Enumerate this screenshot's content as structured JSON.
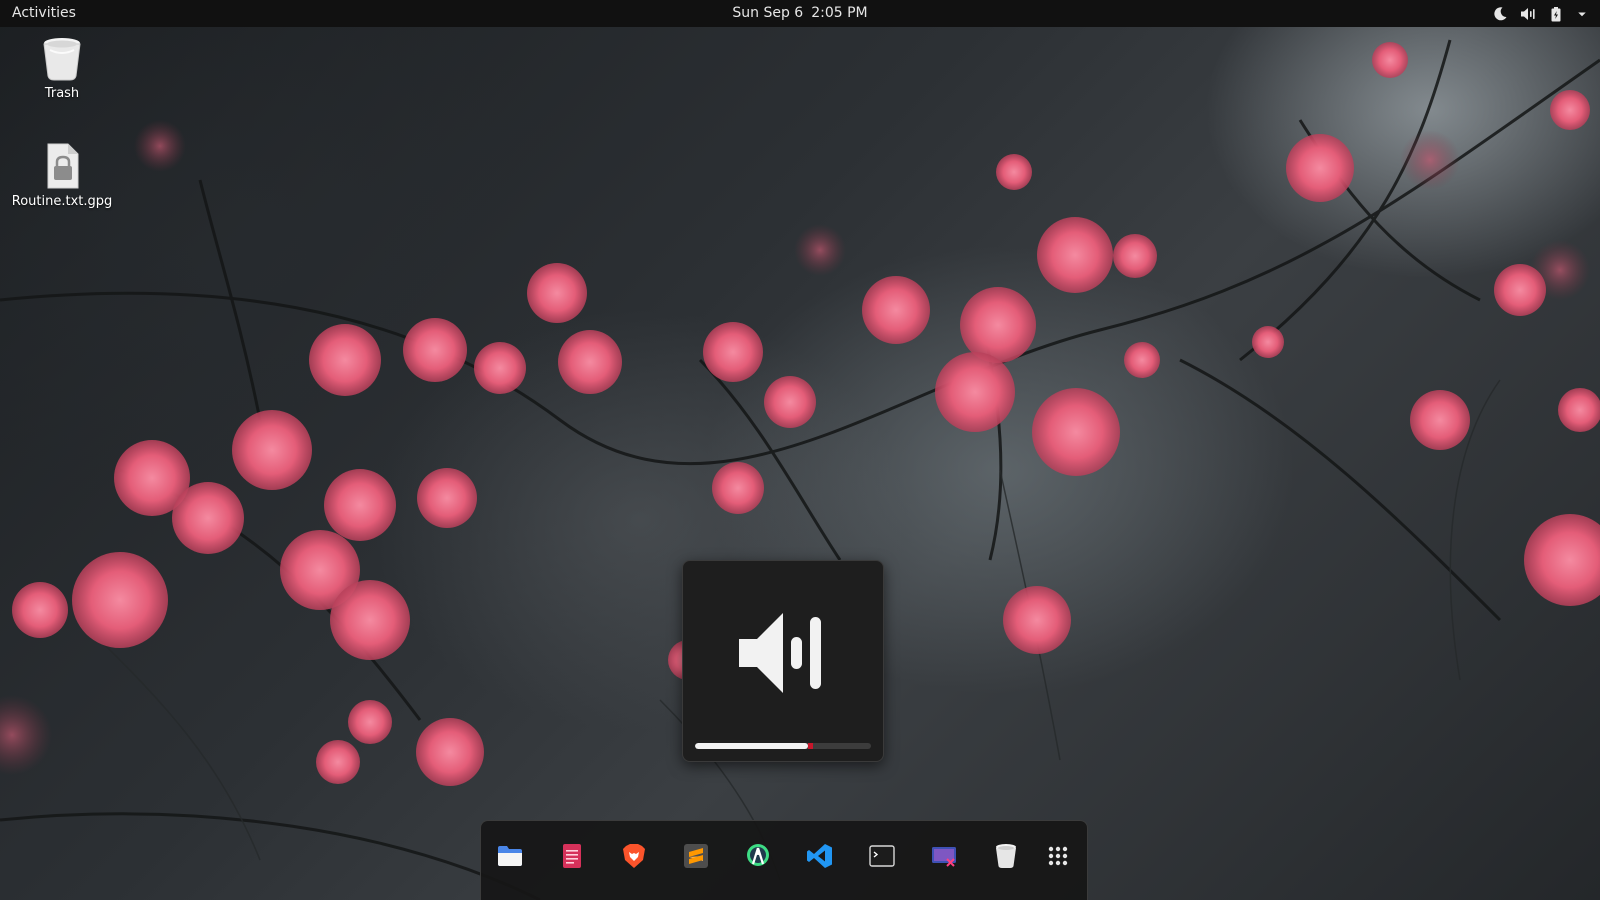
{
  "top_bar": {
    "activities_label": "Activities",
    "date": "Sun Sep 6",
    "time": "2:05 PM",
    "tray_icons": [
      "night-light-icon",
      "volume-icon",
      "battery-icon",
      "system-menu-chevron-icon"
    ]
  },
  "desktop": {
    "icons": [
      {
        "label": "Trash",
        "icon": "trash-icon"
      },
      {
        "label": "Routine.txt.gpg",
        "icon": "locked-file-icon"
      }
    ]
  },
  "volume_osd": {
    "icon": "speaker-high-icon",
    "level_percent": 64,
    "overamplified_marker_percent": 67
  },
  "dock": {
    "items": [
      {
        "app": "files",
        "icon": "files-folder-icon"
      },
      {
        "app": "text-editor",
        "icon": "document-icon"
      },
      {
        "app": "brave-browser",
        "icon": "brave-lion-icon"
      },
      {
        "app": "sublime-text",
        "icon": "sublime-text-icon"
      },
      {
        "app": "android-studio",
        "icon": "android-studio-icon"
      },
      {
        "app": "visual-studio-code",
        "icon": "vscode-icon"
      },
      {
        "app": "terminal",
        "icon": "terminal-icon"
      },
      {
        "app": "screenshot-tool",
        "icon": "screenshot-icon"
      },
      {
        "app": "trash",
        "icon": "trash-icon"
      },
      {
        "app": "show-applications",
        "icon": "app-grid-icon"
      }
    ]
  },
  "colors": {
    "top_bar_bg": "#111111",
    "osd_bg": "#1e1e1e",
    "osd_level": "#f2f2f2",
    "osd_overamp": "#c7162b",
    "blossom_pink": "#e8627a"
  }
}
